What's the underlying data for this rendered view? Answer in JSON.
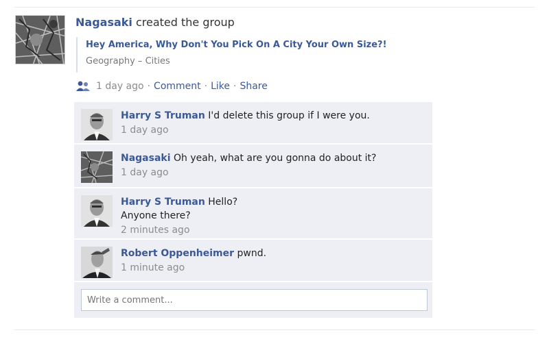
{
  "story": {
    "actor": "Nagasaki",
    "action": "created the group",
    "group_title": "Hey America, Why Don't You Pick On A City Your Own Size?!",
    "group_category": "Geography",
    "separator": "–",
    "group_subcategory": "Cities",
    "time": "1 day ago",
    "actions": {
      "comment": "Comment",
      "like": "Like",
      "share": "Share",
      "dot": "·"
    },
    "icon": "group-icon"
  },
  "comments": [
    {
      "author": "Harry S Truman",
      "text": "I'd delete this group if I were you.",
      "time": "1 day ago",
      "avatar": "portrait"
    },
    {
      "author": "Nagasaki",
      "text": "Oh yeah, what are you gonna do about it?",
      "time": "1 day ago",
      "avatar": "aerial-map"
    },
    {
      "author": "Harry S Truman",
      "text": "Hello?",
      "text2": "Anyone there?",
      "time": "2 minutes ago",
      "avatar": "portrait"
    },
    {
      "author": "Robert Oppenheimer",
      "text": "pwnd.",
      "time": "1 minute ago",
      "avatar": "portrait"
    }
  ],
  "compose": {
    "placeholder": "Write a comment..."
  },
  "colors": {
    "link": "#3b5998",
    "comment_bg": "#edeff4",
    "muted": "#8c8c8c"
  }
}
